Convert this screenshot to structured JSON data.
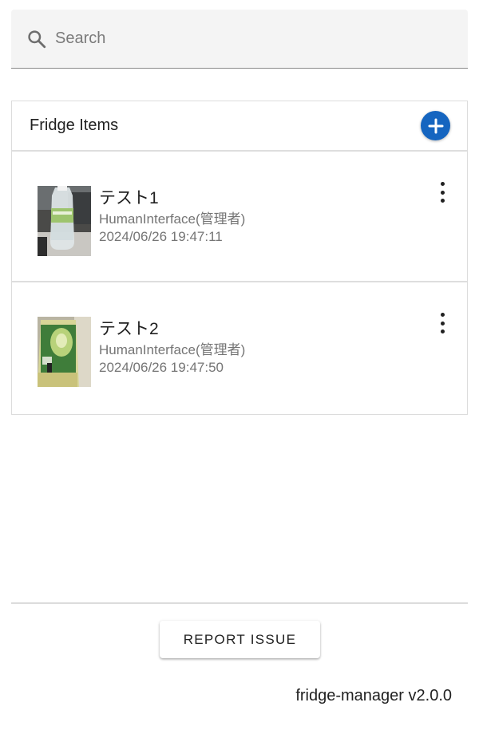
{
  "search": {
    "placeholder": "Search",
    "value": ""
  },
  "list": {
    "title": "Fridge Items",
    "add_icon": "plus-icon",
    "accent_color": "#1565c0",
    "items": [
      {
        "name": "テスト1",
        "owner": "HumanInterface(管理者)",
        "date": "2024/06/26 19:47:11",
        "thumbnail": "water-bottle-photo"
      },
      {
        "name": "テスト2",
        "owner": "HumanInterface(管理者)",
        "date": "2024/06/26 19:47:50",
        "thumbnail": "green-tea-bottle-photo"
      }
    ],
    "item_menu_icon": "more-vertical-icon"
  },
  "footer": {
    "report_label": "REPORT ISSUE",
    "version": "fridge-manager v2.0.0"
  }
}
